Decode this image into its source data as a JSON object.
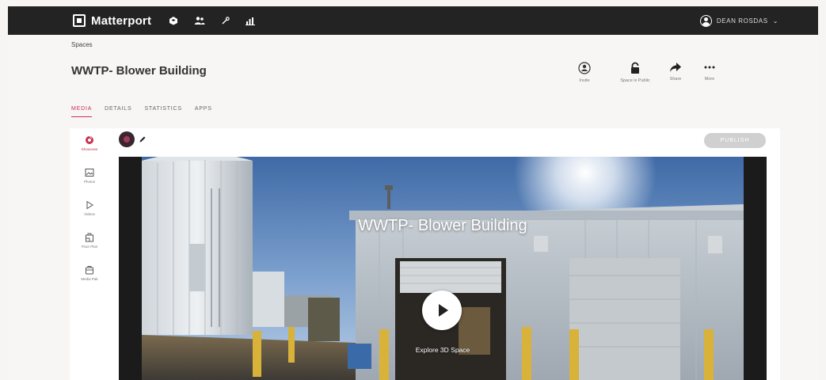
{
  "app": {
    "brand": "Matterport"
  },
  "user": {
    "name": "DEAN ROSDAS",
    "dropdown_glyph": "⌄"
  },
  "breadcrumb": "Spaces",
  "space": {
    "title": "WWTP- Blower Building"
  },
  "actions": [
    {
      "label": "Invite",
      "icon": "invite-icon"
    },
    {
      "label": "Space is Public",
      "icon": "lock-icon"
    },
    {
      "label": "Share",
      "icon": "share-icon"
    },
    {
      "label": "More",
      "icon": "more-icon"
    }
  ],
  "tabs": [
    {
      "label": "MEDIA",
      "active": true
    },
    {
      "label": "DETAILS",
      "active": false
    },
    {
      "label": "STATISTICS",
      "active": false
    },
    {
      "label": "APPS",
      "active": false
    }
  ],
  "sidenav": [
    {
      "label": "Showcase",
      "icon": "showcase-icon",
      "active": true
    },
    {
      "label": "Photos",
      "icon": "photos-icon",
      "active": false
    },
    {
      "label": "Videos",
      "icon": "videos-icon",
      "active": false
    },
    {
      "label": "Floor Plan",
      "icon": "floorplan-icon",
      "active": false
    },
    {
      "label": "Media Pak",
      "icon": "mediapak-icon",
      "active": false
    }
  ],
  "publish_button": "PUBLISH",
  "viewer": {
    "title": "WWTP- Blower Building",
    "cta": "Explore 3D Space"
  },
  "colors": {
    "accent": "#c8304f",
    "topbar": "#232323"
  }
}
